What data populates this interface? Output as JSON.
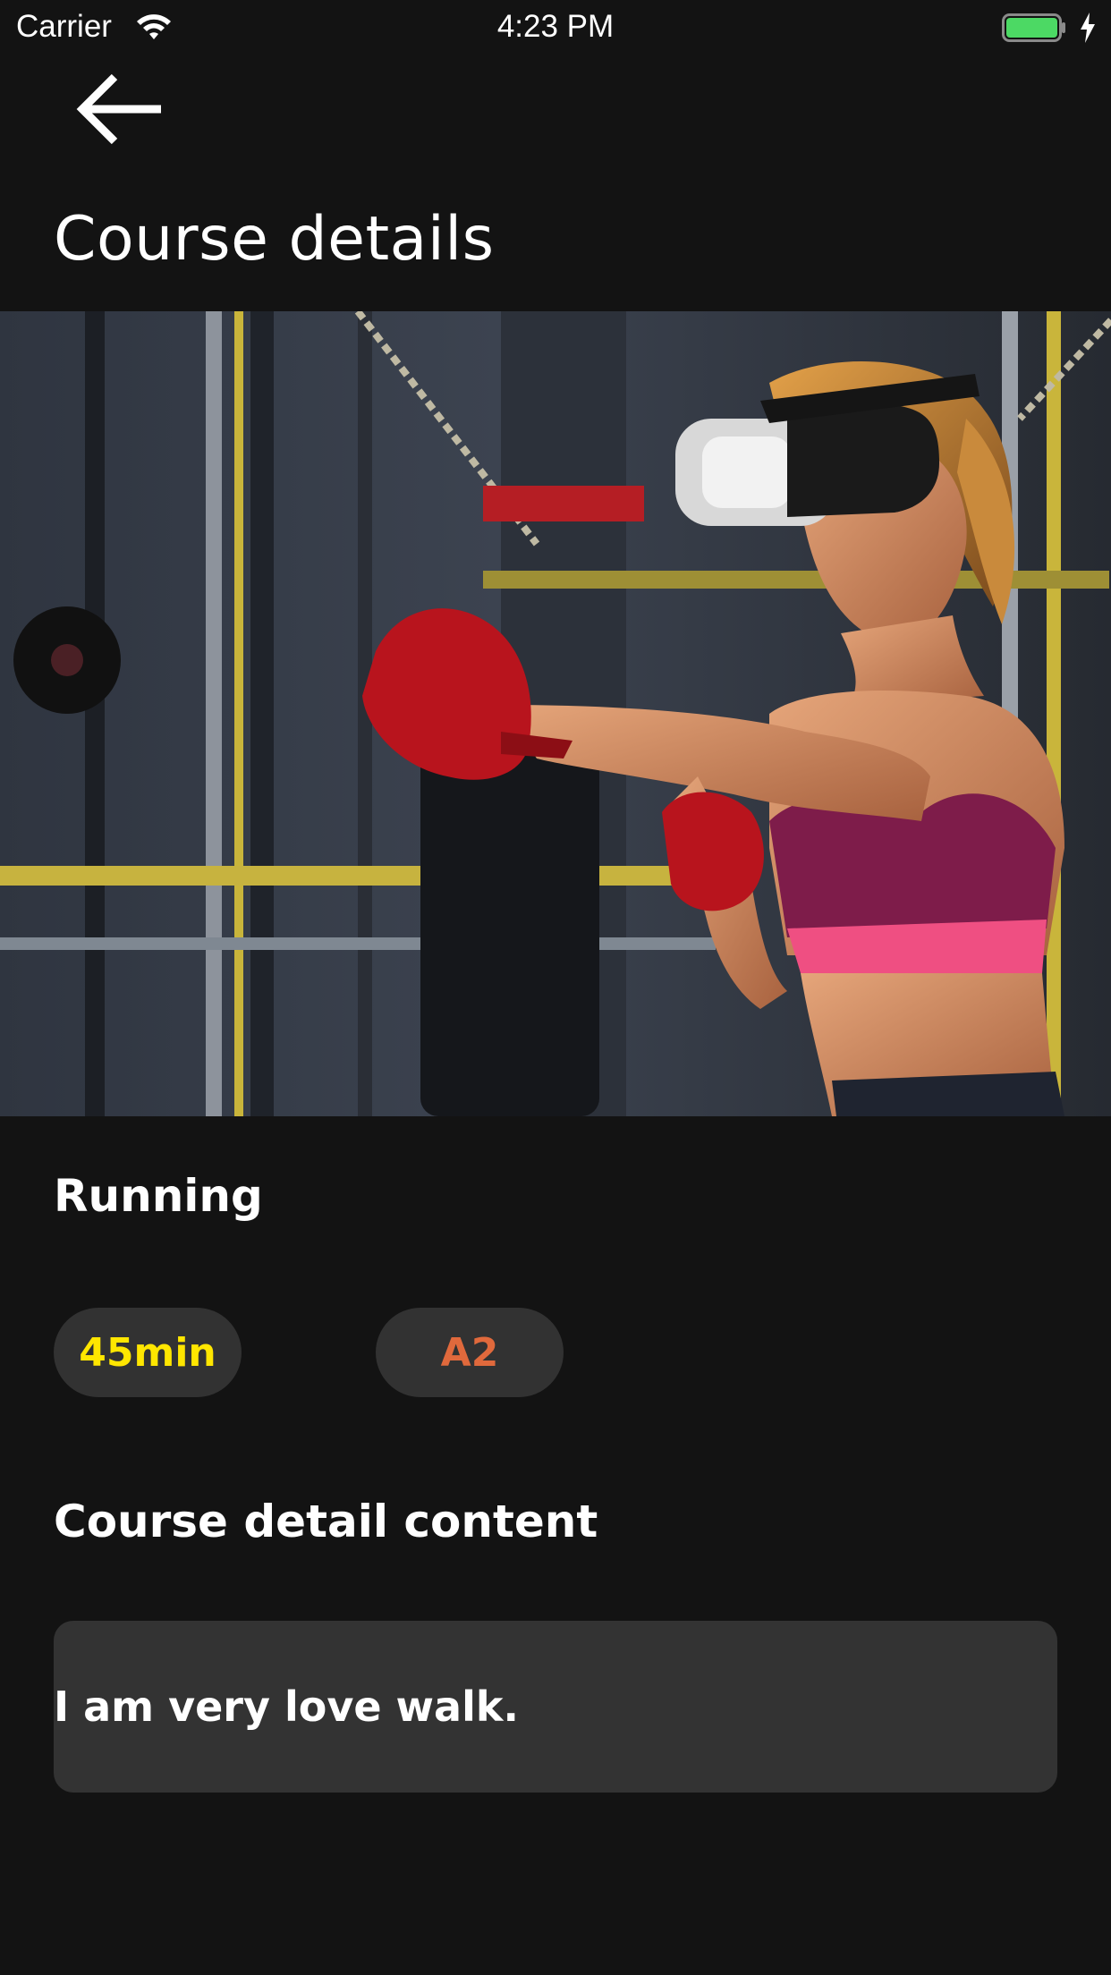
{
  "status_bar": {
    "carrier": "Carrier",
    "time": "4:23 PM",
    "icons": [
      "wifi-icon",
      "battery-icon",
      "charging-bolt-icon"
    ],
    "battery_color": "#4cd964"
  },
  "nav": {
    "back_icon": "arrow-left-icon"
  },
  "page_title": "Course details",
  "hero": {
    "description_icon": "course-photo"
  },
  "course": {
    "name": "Running",
    "duration": "45min",
    "level": "A2",
    "duration_color": "#ffe600",
    "level_color": "#e0693c"
  },
  "detail": {
    "section_title": "Course detail content",
    "content": "I am very love walk."
  },
  "colors": {
    "background": "#131313",
    "chip_background": "#323232",
    "content_background": "#333333"
  }
}
